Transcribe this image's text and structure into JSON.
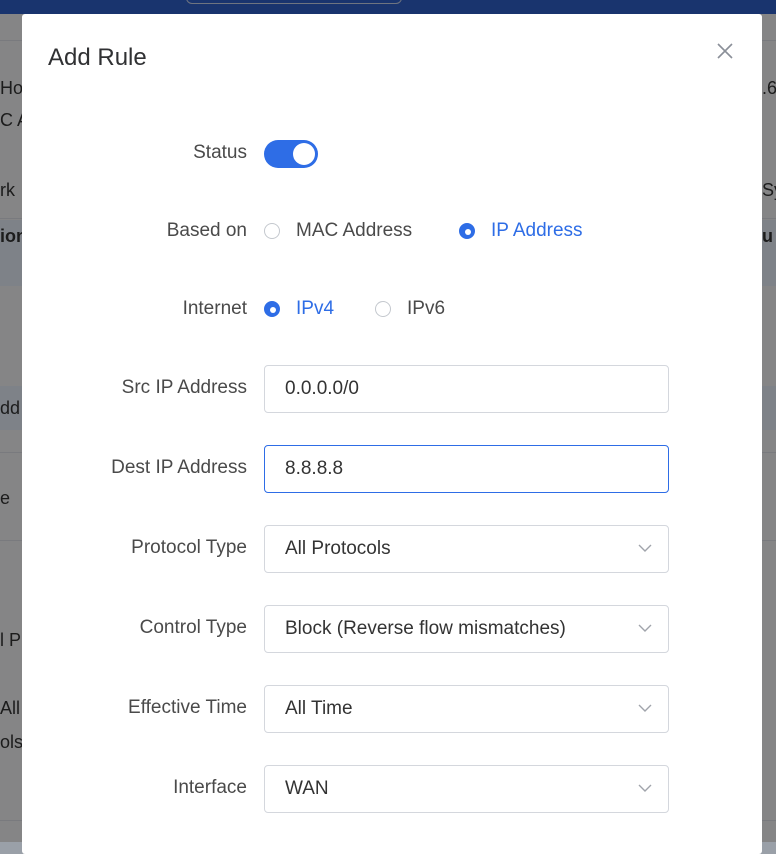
{
  "background": {
    "fragments": [
      {
        "text": "Hos"
      },
      {
        "text": "C A"
      },
      {
        "text": "rk"
      },
      {
        "text": "ion"
      },
      {
        "text": "dd"
      },
      {
        "text": "e"
      },
      {
        "text": "l P"
      },
      {
        "text": "All"
      },
      {
        "text": "ols"
      },
      {
        "text": ".6"
      },
      {
        "text": "Sy"
      },
      {
        "text": "u"
      }
    ]
  },
  "modal": {
    "title": "Add Rule",
    "close_icon": "close-icon"
  },
  "form": {
    "status": {
      "label": "Status",
      "enabled": true
    },
    "based_on": {
      "label": "Based on",
      "options": [
        "MAC Address",
        "IP Address"
      ],
      "selected": "IP Address"
    },
    "internet": {
      "label": "Internet",
      "options": [
        "IPv4",
        "IPv6"
      ],
      "selected": "IPv4"
    },
    "src_ip": {
      "label": "Src IP Address",
      "value": "0.0.0.0/0"
    },
    "dest_ip": {
      "label": "Dest IP Address",
      "value": "8.8.8.8"
    },
    "protocol_type": {
      "label": "Protocol Type",
      "value": "All Protocols"
    },
    "control_type": {
      "label": "Control Type",
      "value": "Block (Reverse flow mismatches)"
    },
    "effective_time": {
      "label": "Effective Time",
      "value": "All Time"
    },
    "interface": {
      "label": "Interface",
      "value": "WAN"
    }
  },
  "colors": {
    "accent": "#2e6de6",
    "label_text": "#4a4a4a",
    "overlay": "rgba(0,0,0,0.45)"
  }
}
